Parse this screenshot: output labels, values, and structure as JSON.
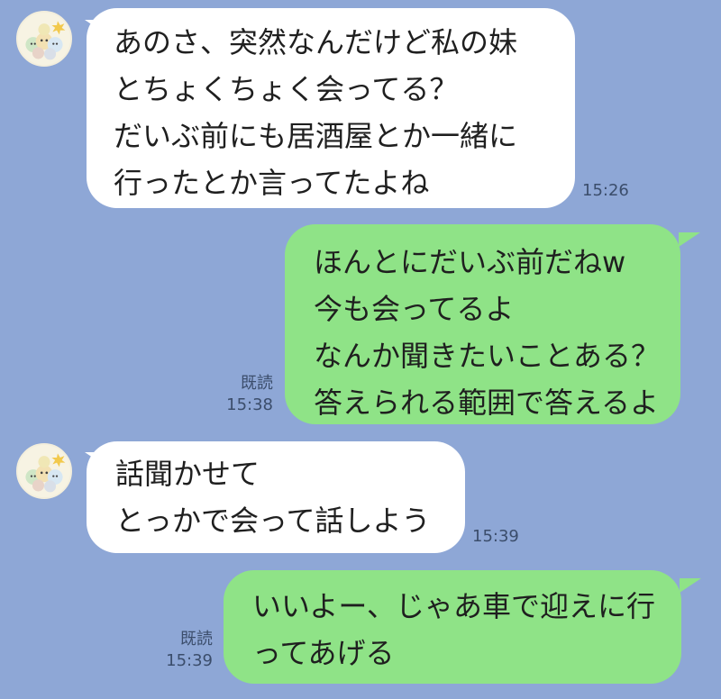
{
  "messages": [
    {
      "direction": "incoming",
      "lines": [
        "あのさ、突然なんだけど私の妹",
        "とちょくちょく会ってる？",
        "だいぶ前にも居酒屋とか一緒に",
        "行ったとか言ってたよね"
      ],
      "time": "15:26"
    },
    {
      "direction": "outgoing",
      "lines": [
        "ほんとにだいぶ前だねw",
        "今も会ってるよ",
        "なんか聞きたいことある？",
        "答えられる範囲で答えるよ"
      ],
      "read": "既読",
      "time": "15:38"
    },
    {
      "direction": "incoming",
      "lines": [
        "話聞かせて",
        "とっかで会って話しよう"
      ],
      "time": "15:39"
    },
    {
      "direction": "outgoing",
      "lines": [
        "いいよー、じゃあ車で迎えに行",
        "ってあげる"
      ],
      "read": "既読",
      "time": "15:39"
    }
  ],
  "colors": {
    "background": "#8ea7d6",
    "incoming_bubble": "#ffffff",
    "outgoing_bubble": "#8fe387"
  },
  "icons": {
    "avatar": "friend-avatar-icon"
  }
}
